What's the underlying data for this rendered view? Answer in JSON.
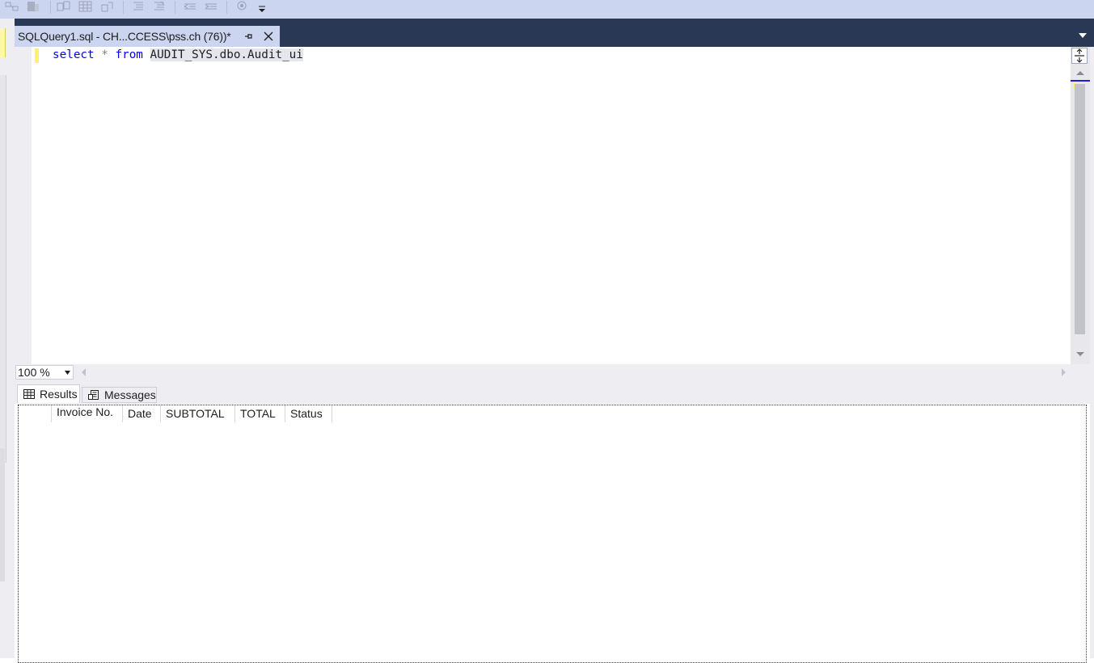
{
  "toolbar": {
    "buttons": [
      {
        "name": "change-connection-icon"
      },
      {
        "name": "database-icon"
      },
      {
        "name": "display-plan-icon"
      },
      {
        "name": "include-results-icon"
      },
      {
        "name": "results-to-grid-icon"
      },
      {
        "name": "results-to-file-icon"
      },
      {
        "name": "comment-icon"
      },
      {
        "name": "uncomment-icon"
      },
      {
        "name": "decrease-indent-icon"
      },
      {
        "name": "increase-indent-icon"
      },
      {
        "name": "specify-values-icon"
      },
      {
        "name": "toolbar-overflow-icon"
      }
    ]
  },
  "document_tab": {
    "title": "SQLQuery1.sql - CH...CCESS\\pss.ch (76))*"
  },
  "editor": {
    "line1": {
      "keyword1": "select",
      "operator": "*",
      "keyword2": "from",
      "object": "AUDIT_SYS.dbo.Audit_ui"
    }
  },
  "zoom": {
    "value": "100 %"
  },
  "results_tabs": {
    "results_label": "Results",
    "messages_label": "Messages"
  },
  "results_grid": {
    "columns": [
      "Invoice No.",
      "Date",
      "SUBTOTAL",
      "TOTAL",
      "Status"
    ],
    "rows": []
  },
  "colors": {
    "tab_bar_background": "#293955",
    "toolbar_background": "#ccd5f0",
    "keyword": "#0000ff",
    "operator": "#808080",
    "change_marker": "#fff26b"
  }
}
